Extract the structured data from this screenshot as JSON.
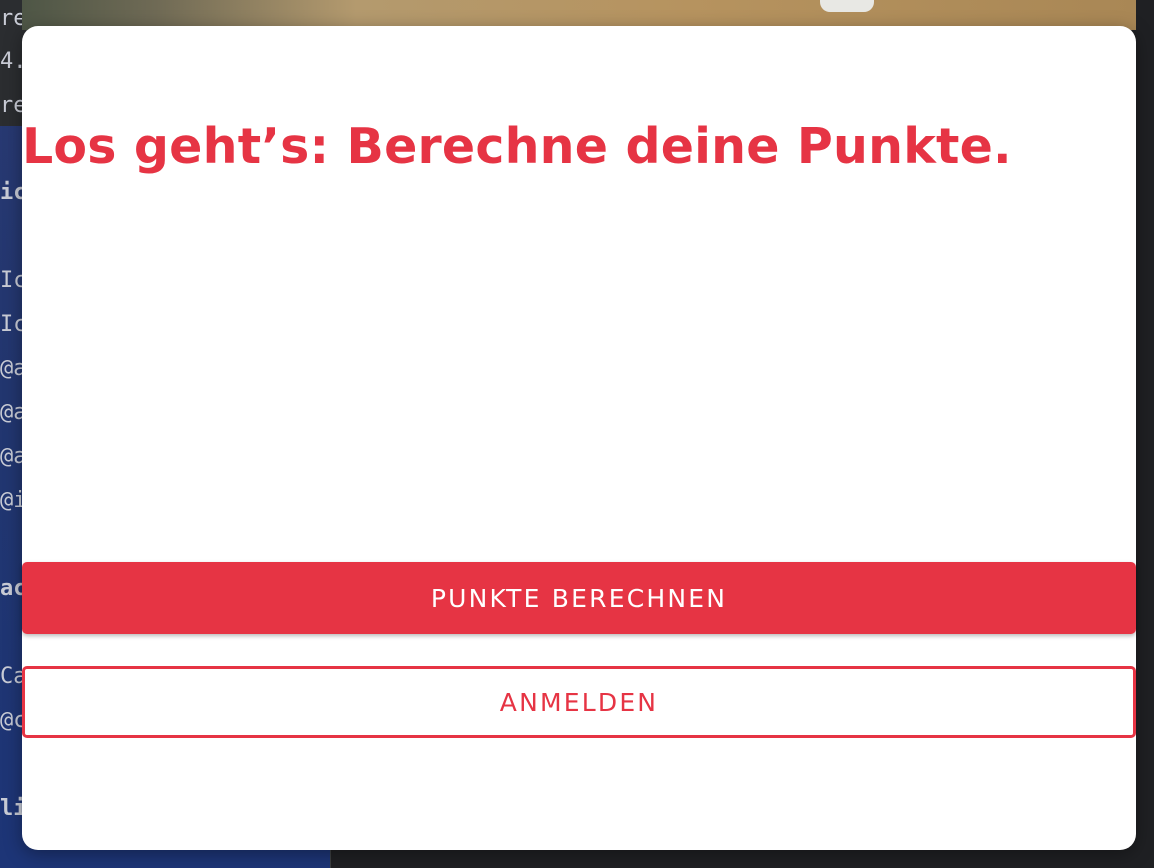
{
  "background": {
    "code_lines": [
      {
        "text": "re",
        "bold": false
      },
      {
        "text": "4.",
        "bold": false
      },
      {
        "text": "re",
        "bold": false
      },
      {
        "text": "ic",
        "bold": true
      },
      {
        "text": "Ic",
        "bold": false
      },
      {
        "text": "Ic",
        "bold": false
      },
      {
        "text": "@a",
        "bold": false
      },
      {
        "text": "@a",
        "bold": false
      },
      {
        "text": "@a",
        "bold": false
      },
      {
        "text": "@i",
        "bold": false
      },
      {
        "text": "ac",
        "bold": true
      },
      {
        "text": "Ca",
        "bold": false
      },
      {
        "text": "@c",
        "bold": false
      },
      {
        "text": "li",
        "bold": true
      }
    ]
  },
  "modal": {
    "title": "Los geht’s: Berechne deine Punkte.",
    "primary_button_label": "PUNKTE BERECHNEN",
    "secondary_button_label": "ANMELDEN"
  },
  "colors": {
    "accent": "#e63444",
    "modal_background": "#ffffff"
  }
}
